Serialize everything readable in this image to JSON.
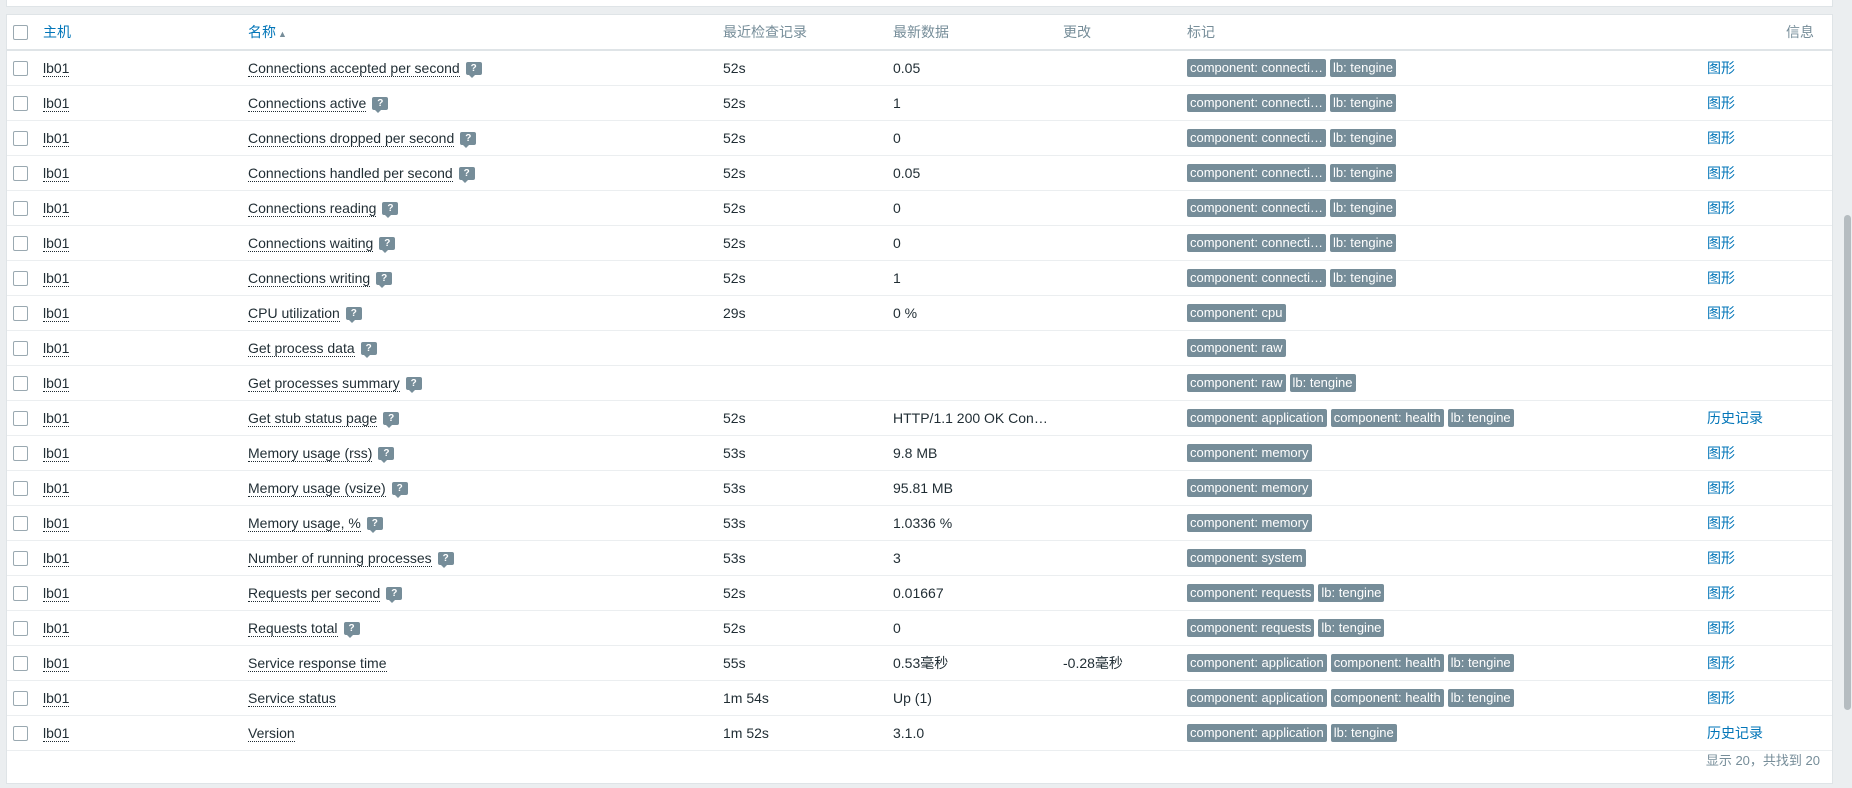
{
  "header": {
    "host": "主机",
    "name": "名称",
    "last_check": "最近检查记录",
    "last_value": "最新数据",
    "change": "更改",
    "tags": "标记",
    "info": "信息"
  },
  "rows": [
    {
      "host": "lb01",
      "name": "Connections accepted per second",
      "hint": true,
      "last_check": "52s",
      "last_value": "0.05",
      "change": "",
      "tags": [
        "component: connecti…",
        "lb: tengine"
      ],
      "info": "图形"
    },
    {
      "host": "lb01",
      "name": "Connections active",
      "hint": true,
      "last_check": "52s",
      "last_value": "1",
      "change": "",
      "tags": [
        "component: connecti…",
        "lb: tengine"
      ],
      "info": "图形"
    },
    {
      "host": "lb01",
      "name": "Connections dropped per second",
      "hint": true,
      "last_check": "52s",
      "last_value": "0",
      "change": "",
      "tags": [
        "component: connecti…",
        "lb: tengine"
      ],
      "info": "图形"
    },
    {
      "host": "lb01",
      "name": "Connections handled per second",
      "hint": true,
      "last_check": "52s",
      "last_value": "0.05",
      "change": "",
      "tags": [
        "component: connecti…",
        "lb: tengine"
      ],
      "info": "图形"
    },
    {
      "host": "lb01",
      "name": "Connections reading",
      "hint": true,
      "last_check": "52s",
      "last_value": "0",
      "change": "",
      "tags": [
        "component: connecti…",
        "lb: tengine"
      ],
      "info": "图形"
    },
    {
      "host": "lb01",
      "name": "Connections waiting",
      "hint": true,
      "last_check": "52s",
      "last_value": "0",
      "change": "",
      "tags": [
        "component: connecti…",
        "lb: tengine"
      ],
      "info": "图形"
    },
    {
      "host": "lb01",
      "name": "Connections writing",
      "hint": true,
      "last_check": "52s",
      "last_value": "1",
      "change": "",
      "tags": [
        "component: connecti…",
        "lb: tengine"
      ],
      "info": "图形"
    },
    {
      "host": "lb01",
      "name": "CPU utilization",
      "hint": true,
      "last_check": "29s",
      "last_value": "0 %",
      "change": "",
      "tags": [
        "component: cpu"
      ],
      "info": "图形"
    },
    {
      "host": "lb01",
      "name": "Get process data",
      "hint": true,
      "last_check": "",
      "last_value": "",
      "change": "",
      "tags": [
        "component: raw"
      ],
      "info": ""
    },
    {
      "host": "lb01",
      "name": "Get processes summary",
      "hint": true,
      "last_check": "",
      "last_value": "",
      "change": "",
      "tags": [
        "component: raw",
        "lb: tengine"
      ],
      "info": ""
    },
    {
      "host": "lb01",
      "name": "Get stub status page",
      "hint": true,
      "last_check": "52s",
      "last_value": "HTTP/1.1 200 OK Conn…",
      "change": "",
      "tags": [
        "component: application",
        "component: health",
        "lb: tengine"
      ],
      "info": "历史记录"
    },
    {
      "host": "lb01",
      "name": "Memory usage (rss)",
      "hint": true,
      "last_check": "53s",
      "last_value": "9.8 MB",
      "change": "",
      "tags": [
        "component: memory"
      ],
      "info": "图形"
    },
    {
      "host": "lb01",
      "name": "Memory usage (vsize)",
      "hint": true,
      "last_check": "53s",
      "last_value": "95.81 MB",
      "change": "",
      "tags": [
        "component: memory"
      ],
      "info": "图形"
    },
    {
      "host": "lb01",
      "name": "Memory usage, %",
      "hint": true,
      "last_check": "53s",
      "last_value": "1.0336 %",
      "change": "",
      "tags": [
        "component: memory"
      ],
      "info": "图形"
    },
    {
      "host": "lb01",
      "name": "Number of running processes",
      "hint": true,
      "last_check": "53s",
      "last_value": "3",
      "change": "",
      "tags": [
        "component: system"
      ],
      "info": "图形"
    },
    {
      "host": "lb01",
      "name": "Requests per second",
      "hint": true,
      "last_check": "52s",
      "last_value": "0.01667",
      "change": "",
      "tags": [
        "component: requests",
        "lb: tengine"
      ],
      "info": "图形"
    },
    {
      "host": "lb01",
      "name": "Requests total",
      "hint": true,
      "last_check": "52s",
      "last_value": "0",
      "change": "",
      "tags": [
        "component: requests",
        "lb: tengine"
      ],
      "info": "图形"
    },
    {
      "host": "lb01",
      "name": "Service response time",
      "hint": false,
      "last_check": "55s",
      "last_value": "0.53毫秒",
      "change": "-0.28毫秒",
      "tags": [
        "component: application",
        "component: health",
        "lb: tengine"
      ],
      "info": "图形"
    },
    {
      "host": "lb01",
      "name": "Service status",
      "hint": false,
      "last_check": "1m 54s",
      "last_value": "Up (1)",
      "change": "",
      "tags": [
        "component: application",
        "component: health",
        "lb: tengine"
      ],
      "info": "图形"
    },
    {
      "host": "lb01",
      "name": "Version",
      "hint": false,
      "last_check": "1m 52s",
      "last_value": "3.1.0",
      "change": "",
      "tags": [
        "component: application",
        "lb: tengine"
      ],
      "info": "历史记录"
    }
  ],
  "hint_glyph": "?",
  "sort_glyph": "▲",
  "footer": "显示 20，共找到 20",
  "colors": {
    "link": "#0275b8",
    "tag_bg": "#768d99",
    "header_text": "#768d99"
  }
}
